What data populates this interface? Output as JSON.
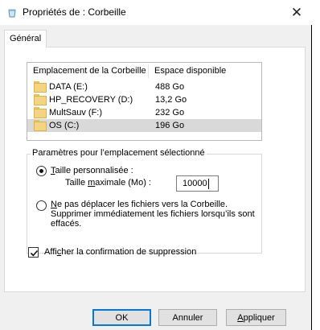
{
  "window": {
    "title": "Propriétés de : Corbeille"
  },
  "tabs": [
    {
      "label": "Général"
    }
  ],
  "locations": {
    "columns": [
      "Emplacement de la Corbeille",
      "Espace disponible"
    ],
    "rows": [
      {
        "name": "DATA (E:)",
        "space": "488 Go",
        "selected": false
      },
      {
        "name": "HP_RECOVERY (D:)",
        "space": "13,2 Go",
        "selected": false
      },
      {
        "name": "MultSauv (F:)",
        "space": "232 Go",
        "selected": false
      },
      {
        "name": "OS (C:)",
        "space": "196 Go",
        "selected": true
      }
    ]
  },
  "settings": {
    "legend": "Paramètres pour l’emplacement sélectionné",
    "custom_size": {
      "label_key": "T",
      "label_rest": "aille personnalisée :",
      "max_label_pre": "Taille ",
      "max_label_key": "m",
      "max_label_post": "aximale (Mo) :",
      "value": "10000",
      "checked": true
    },
    "no_move": {
      "label_key": "N",
      "label_rest": "e pas déplacer les fichiers vers la Corbeille.",
      "line2": "Supprimer immédiatement les fichiers lorsqu’ils sont",
      "line3": "effacés.",
      "checked": false
    }
  },
  "confirm": {
    "label_pre": "Affi",
    "label_key": "c",
    "label_post": "her la confirmation de suppression",
    "checked": true
  },
  "buttons": {
    "ok": "OK",
    "cancel": "Annuler",
    "apply_key": "A",
    "apply_rest": "ppliquer"
  },
  "colors": {
    "selection": "#d9d9d9",
    "default_button_border": "#0078d7",
    "folder": "#f5d481"
  },
  "icons": {
    "title": "recycle-bin-icon",
    "close": "close-icon",
    "drive": "folder-icon",
    "check": "checkmark-icon"
  }
}
